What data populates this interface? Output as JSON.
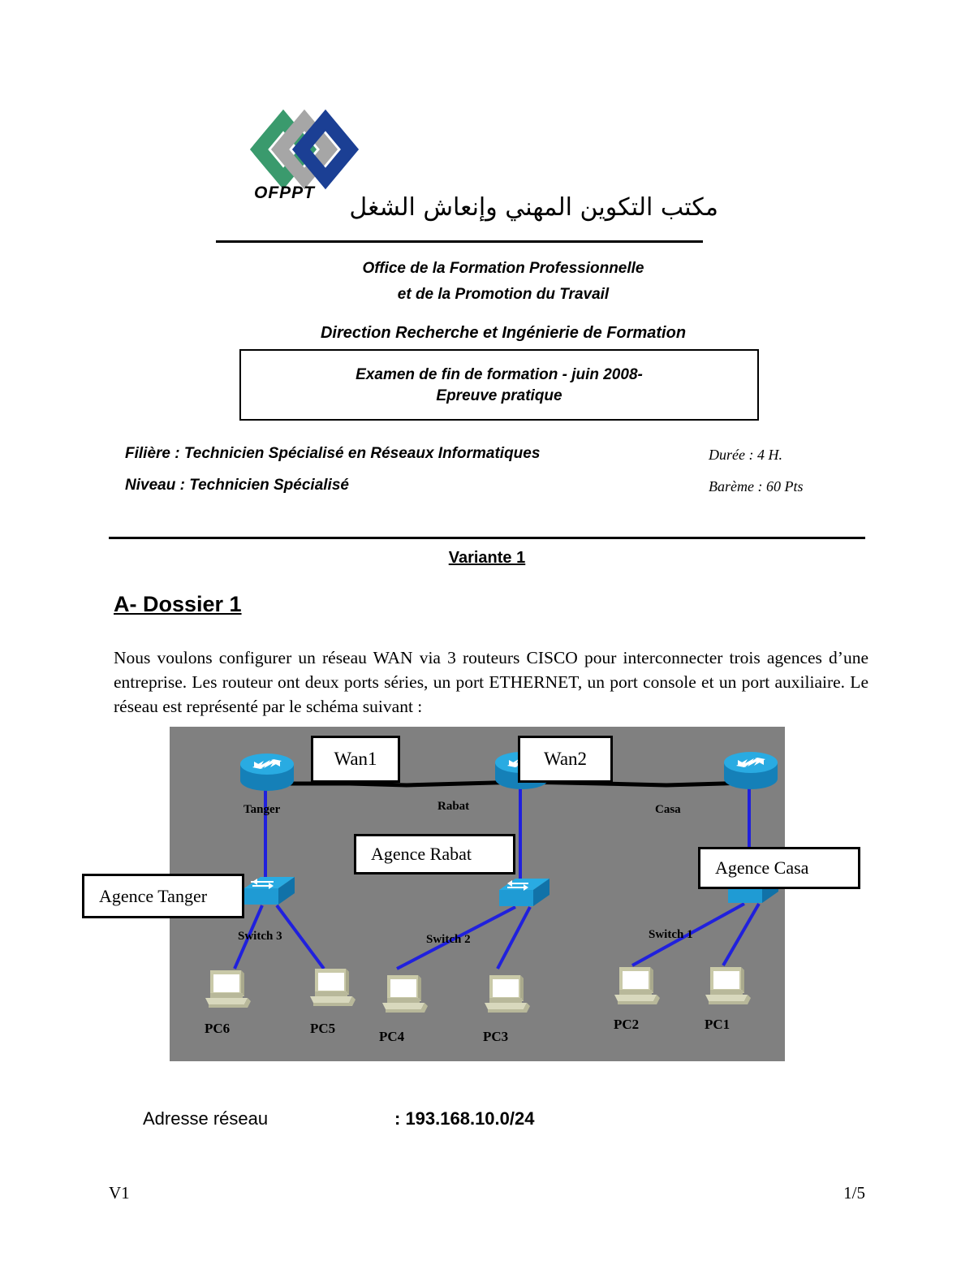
{
  "header": {
    "logo_word": "OFPPT",
    "arabic_title": "مكتب التكوين المهني وإنعاش الشغل",
    "office_line_1": "Office de la Formation Professionnelle",
    "office_line_2": "et de la Promotion du Travail",
    "direction_line": "Direction Recherche et Ingénierie de Formation"
  },
  "exam_box": {
    "title": "Examen de fin de formation - juin 2008-",
    "subtitle": "Epreuve pratique"
  },
  "meta": {
    "filiere": "Filière   : Technicien Spécialisé en  Réseaux Informatiques",
    "niveau": "Niveau : Technicien Spécialisé",
    "duree": "Durée : 4 H.",
    "bareme": "Barème : 60 Pts"
  },
  "body": {
    "variante": "Variante 1",
    "dossier_title": "A- Dossier 1",
    "intro_paragraph": "Nous voulons configurer un réseau WAN via 3 routeurs CISCO pour interconnecter trois agences d’une entreprise. Les routeur ont deux ports séries, un port ETHERNET, un port console et un port auxiliaire.  Le réseau est représenté par le schéma suivant :"
  },
  "diagram": {
    "background_color": "#808080",
    "link_color_lan": "#2020DD",
    "link_color_wan": "#000000",
    "routers": [
      {
        "label": "Tanger"
      },
      {
        "label": "Rabat"
      },
      {
        "label": "Casa"
      }
    ],
    "wan_links": [
      {
        "label": "Wan1"
      },
      {
        "label": "Wan2"
      }
    ],
    "switches": [
      {
        "label": "Switch 3"
      },
      {
        "label": "Switch 2"
      },
      {
        "label": "Switch 1"
      }
    ],
    "agency_callouts": [
      {
        "label": "Agence Tanger"
      },
      {
        "label": "Agence Rabat"
      },
      {
        "label": "Agence Casa"
      }
    ],
    "pcs": [
      {
        "label": "PC6"
      },
      {
        "label": "PC5"
      },
      {
        "label": "PC4"
      },
      {
        "label": "PC3"
      },
      {
        "label": "PC2"
      },
      {
        "label": "PC1"
      }
    ]
  },
  "footer": {
    "adresse_label": "Adresse réseau",
    "adresse_value": ": 193.168.10.0/24",
    "version": "V1",
    "page": "1/5"
  }
}
